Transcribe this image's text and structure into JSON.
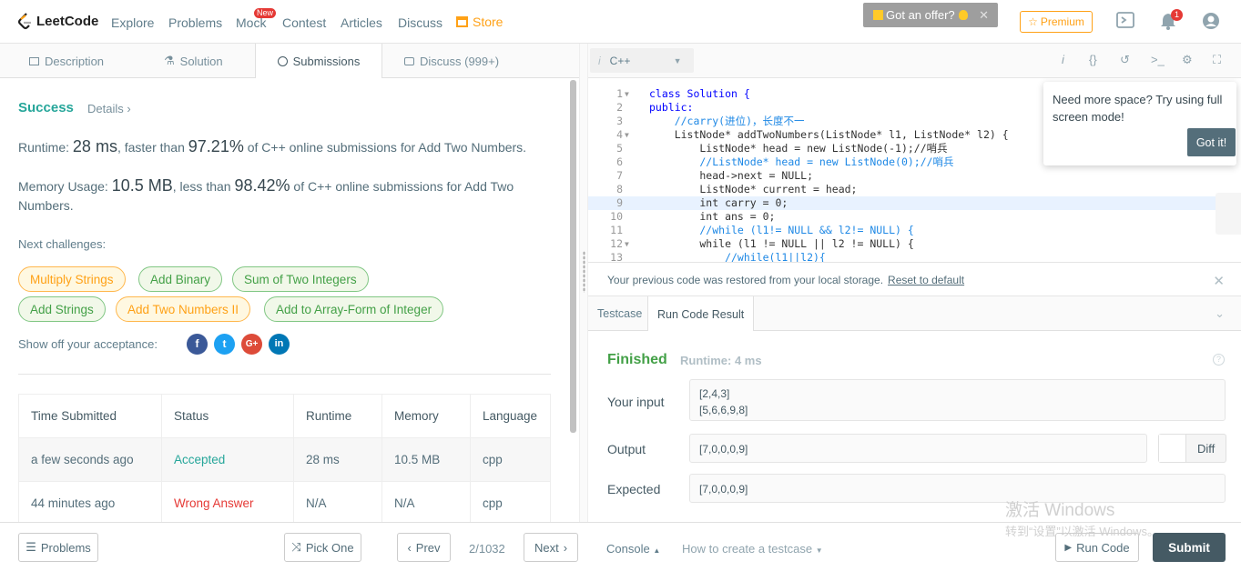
{
  "nav": {
    "logo_text": "LeetCode",
    "items": [
      "Explore",
      "Problems",
      "Mock",
      "Contest",
      "Articles",
      "Discuss"
    ],
    "store": "Store",
    "mock_badge": "New",
    "offer": "Got an offer?",
    "premium": "Premium",
    "notification_count": "1"
  },
  "left_tabs": [
    "Description",
    "Solution",
    "Submissions",
    "Discuss (999+)"
  ],
  "result": {
    "status": "Success",
    "details": "Details",
    "runtime_prefix": "Runtime: ",
    "runtime_value": "28 ms",
    "runtime_mid": ", faster than ",
    "runtime_pct": "97.21%",
    "runtime_suffix": " of C++ online submissions for Add Two Numbers.",
    "memory_prefix": "Memory Usage: ",
    "memory_value": "10.5 MB",
    "memory_mid": ", less than ",
    "memory_pct": "98.42%",
    "memory_suffix": " of C++ online submissions for Add Two Numbers."
  },
  "next_challenges": {
    "label": "Next challenges:",
    "items": [
      {
        "label": "Multiply Strings",
        "difficulty": "medium"
      },
      {
        "label": "Add Binary",
        "difficulty": "easy"
      },
      {
        "label": "Sum of Two Integers",
        "difficulty": "easy"
      },
      {
        "label": "Add Strings",
        "difficulty": "easy"
      },
      {
        "label": "Add Two Numbers II",
        "difficulty": "medium"
      },
      {
        "label": "Add to Array-Form of Integer",
        "difficulty": "easy"
      }
    ]
  },
  "share": {
    "label": "Show off your acceptance:",
    "icons": [
      "facebook-icon",
      "twitter-icon",
      "google-plus-icon",
      "linkedin-icon"
    ],
    "colors": [
      "#3b5998",
      "#1da1f2",
      "#dd4b39",
      "#0077b5"
    ]
  },
  "submissions": {
    "headers": [
      "Time Submitted",
      "Status",
      "Runtime",
      "Memory",
      "Language"
    ],
    "rows": [
      [
        "a few seconds ago",
        "Accepted",
        "28 ms",
        "10.5 MB",
        "cpp"
      ],
      [
        "44 minutes ago",
        "Wrong Answer",
        "N/A",
        "N/A",
        "cpp"
      ]
    ],
    "status_colors": {
      "Accepted": "#26a69a",
      "Wrong Answer": "#e53935"
    }
  },
  "bottom": {
    "problems": "Problems",
    "pick_one": "Pick One",
    "prev": "Prev",
    "page": "2/1032",
    "next": "Next",
    "console": "Console",
    "howto": "How to create a testcase",
    "run_code": "Run Code",
    "submit": "Submit"
  },
  "editor": {
    "language": "C++",
    "lines": [
      "class Solution {",
      "public:",
      "    //carry(进位)，长度不一",
      "    ListNode* addTwoNumbers(ListNode* l1, ListNode* l2) {",
      "        ListNode* head = new ListNode(-1);//哨兵",
      "        //ListNode* head = new ListNode(0);//哨兵",
      "        head->next = NULL;",
      "        ListNode* current = head;",
      "        int carry = 0;",
      "        int ans = 0;",
      "        //while (l1!= NULL && l2!= NULL) {",
      "        while (l1 != NULL || l2 != NULL) {",
      "            //while(l1||l2){"
    ],
    "line_numbers": [
      "1",
      "2",
      "3",
      "4",
      "5",
      "6",
      "7",
      "8",
      "9",
      "10",
      "11",
      "12",
      "13"
    ]
  },
  "tooltip": {
    "message": "Need more space? Try using full screen mode!",
    "button": "Got it!"
  },
  "restore": {
    "message": "Your previous code was restored from your local storage.",
    "link": "Reset to default"
  },
  "result_tabs": [
    "Testcase",
    "Run Code Result"
  ],
  "run_result": {
    "status": "Finished",
    "runtime": "Runtime: 4 ms",
    "input_label": "Your input",
    "input_lines": [
      "[2,4,3]",
      "[5,6,6,9,8]"
    ],
    "output_label": "Output",
    "output": "[7,0,0,0,9]",
    "expected_label": "Expected",
    "expected": "[7,0,0,0,9]",
    "diff": "Diff"
  },
  "watermark": {
    "line1": "激活 Windows",
    "line2": "转到“设置”以激活 Windows。"
  }
}
